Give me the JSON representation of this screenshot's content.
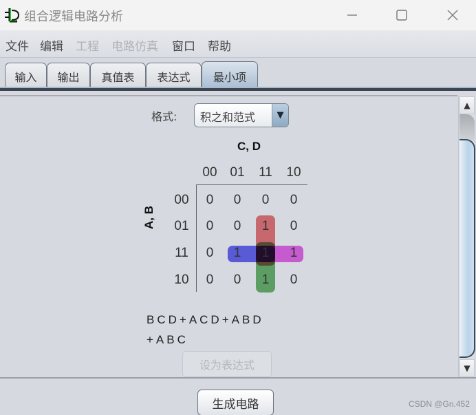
{
  "window": {
    "title": "组合逻辑电路分析",
    "icon": "logisim-icon",
    "controls": {
      "minimize": "minimize-icon",
      "maximize": "maximize-icon",
      "close": "close-icon"
    }
  },
  "menubar": {
    "items": [
      {
        "label": "文件",
        "enabled": true
      },
      {
        "label": "编辑",
        "enabled": true
      },
      {
        "label": "工程",
        "enabled": false
      },
      {
        "label": "电路仿真",
        "enabled": false
      },
      {
        "label": "窗口",
        "enabled": true
      },
      {
        "label": "帮助",
        "enabled": true
      }
    ]
  },
  "tabs": [
    {
      "label": "输入",
      "active": false
    },
    {
      "label": "输出",
      "active": false
    },
    {
      "label": "真值表",
      "active": false
    },
    {
      "label": "表达式",
      "active": false
    },
    {
      "label": "最小项",
      "active": true
    }
  ],
  "format": {
    "label": "格式:",
    "selected": "积之和范式"
  },
  "kmap": {
    "col_variables": "C, D",
    "row_variables": "A, B",
    "col_labels": [
      "00",
      "01",
      "11",
      "10"
    ],
    "row_labels": [
      "00",
      "01",
      "11",
      "10"
    ],
    "cells": [
      [
        "0",
        "0",
        "0",
        "0"
      ],
      [
        "0",
        "0",
        "1",
        "0"
      ],
      [
        "0",
        "1",
        "1",
        "1"
      ],
      [
        "0",
        "0",
        "1",
        "0"
      ]
    ],
    "groups": [
      {
        "term": "BCD",
        "color": "#e8585c",
        "rows": [
          1,
          2
        ],
        "cols": [
          2,
          2
        ]
      },
      {
        "term": "ACD",
        "color": "#4aa84e",
        "rows": [
          2,
          3
        ],
        "cols": [
          2,
          2
        ]
      },
      {
        "term": "ABD",
        "color": "#4444f0",
        "rows": [
          2,
          2
        ],
        "cols": [
          1,
          2
        ]
      },
      {
        "term": "ABC",
        "color": "#e844e8",
        "rows": [
          2,
          2
        ],
        "cols": [
          2,
          3
        ]
      }
    ]
  },
  "expression": {
    "line1": "BCD+ACD+ABD",
    "line2": "+ABC"
  },
  "buttons": {
    "set_expression": "设为表达式",
    "generate_circuit": "生成电路"
  },
  "scrollbar": {
    "up": "scroll-up-arrow-icon",
    "down": "scroll-down-arrow-icon"
  },
  "watermark": "CSDN @Gn.452"
}
